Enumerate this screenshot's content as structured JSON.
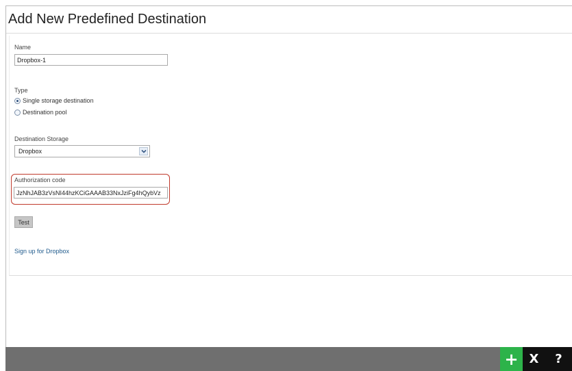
{
  "page": {
    "title": "Add New Predefined Destination"
  },
  "form": {
    "name": {
      "label": "Name",
      "value": "Dropbox-1"
    },
    "type": {
      "label": "Type",
      "options": [
        {
          "label": "Single storage destination",
          "selected": true
        },
        {
          "label": "Destination pool",
          "selected": false
        }
      ]
    },
    "destination_storage": {
      "label": "Destination Storage",
      "selected": "Dropbox"
    },
    "authorization_code": {
      "label": "Authorization code",
      "value": "JzNhJAB3zVsNI44hzKCiGAAAB33NxJziFg4hQybVz"
    },
    "test_label": "Test",
    "signup_link": "Sign up for Dropbox"
  },
  "footer": {
    "add_glyph": "+",
    "close_glyph": "X",
    "help_glyph": "?",
    "colors": {
      "bar": "#6f6f6f",
      "add": "#2db34a",
      "dark": "#111111"
    }
  },
  "colors": {
    "highlight_outline": "#c0392b",
    "link": "#1f5a8c"
  }
}
